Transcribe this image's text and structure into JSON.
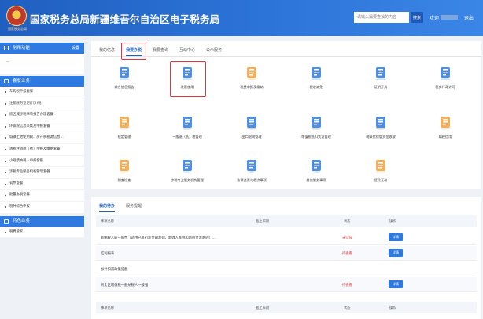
{
  "header": {
    "emblem_text": "国家税务总局",
    "title": "国家税务总局新疆维吾尔自治区电子税务局",
    "search_placeholder": "请输入需要查找的内容",
    "search_button": "搜索",
    "welcome": "欢迎",
    "logout": "退出"
  },
  "sidebar": {
    "common": "常用功能",
    "settings": "设置",
    "hot": "套餐业务",
    "dash": "--",
    "items": [
      "车购税申报套餐",
      "注销税务登记(代2)税",
      "房区域涉税事项报告办理套餐",
      "环保税信息采集及申报套餐",
      "城镇土地使用税、房产税税源信息…",
      "清税注销税（费）申报及缴纳套餐",
      "小规模纳税人申报套餐",
      "涉税专业服务机构管理套餐",
      "发票套餐",
      "批量办税套餐",
      "税种综合申报"
    ],
    "special": "特色业务",
    "special_items": [
      "税费管家"
    ]
  },
  "tabs": [
    "我的信息",
    "我要办税",
    "我要查询",
    "互动中心",
    "公众服务"
  ],
  "grid": [
    {
      "label": "综合信息报告",
      "icon": "report-icon",
      "color": "#3b82e0"
    },
    {
      "label": "发票使用",
      "icon": "invoice-icon",
      "color": "#3b82e0"
    },
    {
      "label": "税费申报及缴纳",
      "icon": "tax-payment-icon",
      "color": "#f2a64a"
    },
    {
      "label": "税收减免",
      "icon": "tax-reduction-icon",
      "color": "#3b82e0"
    },
    {
      "label": "证明开具",
      "icon": "certificate-icon",
      "color": "#3b82e0"
    },
    {
      "label": "税务行政许可",
      "icon": "license-icon",
      "color": "#3b82e0"
    },
    {
      "label": "核定管理",
      "icon": "approval-icon",
      "color": "#f2a64a"
    },
    {
      "label": "一般退（抵）税管理",
      "icon": "refund-icon",
      "color": "#3b82e0"
    },
    {
      "label": "出口退税管理",
      "icon": "export-refund-icon",
      "color": "#3b82e0"
    },
    {
      "label": "增值税抵扣凭证管理",
      "icon": "vat-voucher-icon",
      "color": "#3b82e0"
    },
    {
      "label": "税收代保管资金收取",
      "icon": "custody-icon",
      "color": "#3b82e0"
    },
    {
      "label": "纳税信用",
      "icon": "credit-icon",
      "color": "#f2a64a"
    },
    {
      "label": "稽查检查",
      "icon": "inspection-icon",
      "color": "#f2a64a"
    },
    {
      "label": "涉税专业服务机构管理",
      "icon": "agency-icon",
      "color": "#3b82e0"
    },
    {
      "label": "法律追责与救济事项",
      "icon": "gavel-icon",
      "color": "#3b82e0"
    },
    {
      "label": "其他服务事项",
      "icon": "heart-hand-icon",
      "color": "#3b82e0"
    },
    {
      "label": "便民互动",
      "icon": "interaction-icon",
      "color": "#f2a64a"
    }
  ],
  "todo": {
    "tabs": [
      "我的待办",
      "服务提醒"
    ],
    "columns": [
      "事项名称",
      "截止日期",
      "状态",
      "操作"
    ],
    "rows": [
      {
        "name": "新纳税人的一般性（适用已执行新金融准则、新收入准则和新租赁准则的）…",
        "status": "未完成",
        "action": "详情"
      },
      {
        "name": "红利报表",
        "status": "待查看",
        "action": "详情"
      },
      {
        "name": "加计扣减政策提醒",
        "status": "",
        "action": ""
      },
      {
        "name": "附全区增值税一般纳税人一般强",
        "status": "待查看",
        "action": "详情"
      }
    ]
  },
  "colors": {
    "brand_blue": "#1f5fc0",
    "accent_red": "#e5333b",
    "warm": "#f2a64a"
  }
}
